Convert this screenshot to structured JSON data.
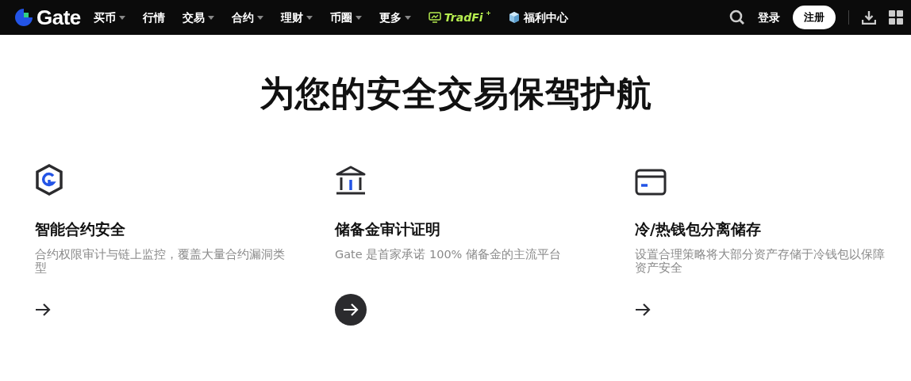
{
  "navbar": {
    "logo": "Gate",
    "items": [
      {
        "label": "买币",
        "has_menu": true
      },
      {
        "label": "行情",
        "has_menu": false
      },
      {
        "label": "交易",
        "has_menu": true
      },
      {
        "label": "合约",
        "has_menu": true
      },
      {
        "label": "理财",
        "has_menu": true
      },
      {
        "label": "币圈",
        "has_menu": true
      },
      {
        "label": "更多",
        "has_menu": true
      }
    ],
    "tradfi": "TradFi",
    "welfare": "福利中心",
    "login": "登录",
    "register": "注册"
  },
  "headline": "为您的安全交易保驾护航",
  "features": [
    {
      "kind": "shield",
      "title": "智能合约安全",
      "description": "合约权限审计与链上监控，覆盖大量合约漏洞类型",
      "selected": false
    },
    {
      "kind": "bank",
      "title": "储备金审计证明",
      "description": "Gate 是首家承诺 100% 储备金的主流平台",
      "selected": true
    },
    {
      "kind": "card",
      "title": "冷/热钱包分离储存",
      "description": "设置合理策略将大部分资产存储于冷钱包以保障资产安全",
      "selected": false
    }
  ]
}
